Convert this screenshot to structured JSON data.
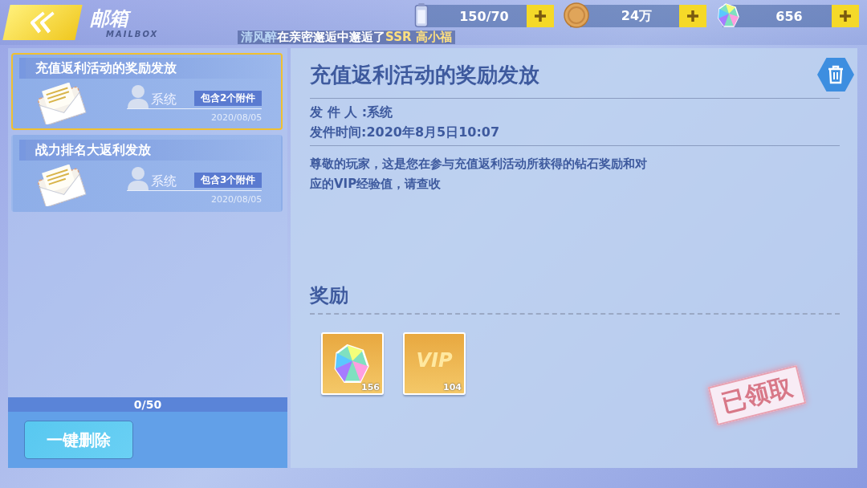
{
  "header": {
    "title": "邮箱",
    "subtitle": "MAILBOX",
    "ticker": {
      "player": "清风醉",
      "message": "在亲密邂逅中邂逅了",
      "reward": "SSR 高小福"
    }
  },
  "currencies": [
    {
      "kind": "stamina",
      "value": "150/70"
    },
    {
      "kind": "coin",
      "value": "24万"
    },
    {
      "kind": "diamond",
      "value": "656"
    }
  ],
  "mails": [
    {
      "title": "充值返利活动的奖励发放",
      "sender": "系统",
      "attachments": "包含2个附件",
      "date": "2020/08/05",
      "selected": true
    },
    {
      "title": "战力排名大返利发放",
      "sender": "系统",
      "attachments": "包含3个附件",
      "date": "2020/08/05",
      "selected": false
    }
  ],
  "mail_count": "0/50",
  "delete_all_button": "一键删除",
  "detail": {
    "title": "充值返利活动的奖励发放",
    "sender": "发 件 人 :系统",
    "time": "发件时间:2020年8月5日10:07",
    "body": "尊敬的玩家，这是您在参与充值返利活动所获得的钻石奖励和对应的VIP经验值，请查收",
    "rewards_heading": "奖励",
    "rewards": [
      {
        "kind": "diamond",
        "count": "156"
      },
      {
        "kind": "vip",
        "label": "VIP",
        "count": "104"
      }
    ],
    "stamp": "已领取"
  }
}
